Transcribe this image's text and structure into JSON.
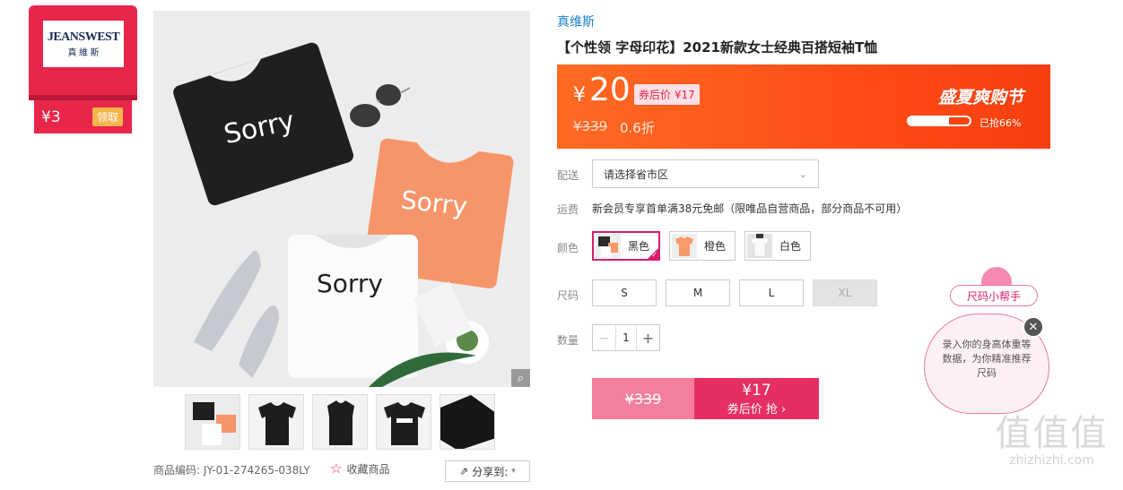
{
  "coupon": {
    "brand_logo_main": "JEANSWEST",
    "brand_logo_sub": "真 維 斯",
    "amount": "¥3",
    "claim_label": "领取"
  },
  "gallery": {
    "sku_label": "商品编码: JY-01-274265-038LY",
    "favorite_label": "收藏商品",
    "share_label": "分享到:",
    "tshirt_text": "Sorry",
    "thumbnails": [
      "thumb-1",
      "thumb-2",
      "thumb-3",
      "thumb-4",
      "thumb-5"
    ]
  },
  "product": {
    "brand": "真维斯",
    "title": "【个性领 字母印花】2021新款女士经典百搭短袖T恤"
  },
  "promo": {
    "currency": "¥",
    "price": "20",
    "after_coupon": "券后价 ¥17",
    "original_price": "¥339",
    "discount": "0.6折",
    "event_title": "盛夏爽购节",
    "sold_percent": 0.66,
    "sold_label": "已抢66%",
    "colors": {
      "start": "#ff6a23",
      "end": "#f63e0f"
    }
  },
  "shipping": {
    "label": "配送",
    "placeholder": "请选择省市区"
  },
  "freight": {
    "label": "运费",
    "text": "新会员专享首单满38元免邮（限唯品自营商品，部分商品不可用）"
  },
  "color": {
    "label": "颜色",
    "options": [
      {
        "name": "黑色",
        "selected": true,
        "swatch": "#2a2a2a"
      },
      {
        "name": "橙色",
        "selected": false,
        "swatch": "#f89a6a"
      },
      {
        "name": "白色",
        "selected": false,
        "swatch": "#f0f0f0"
      }
    ]
  },
  "size": {
    "label": "尺码",
    "options": [
      {
        "name": "S",
        "disabled": false
      },
      {
        "name": "M",
        "disabled": false
      },
      {
        "name": "L",
        "disabled": false
      },
      {
        "name": "XL",
        "disabled": true
      }
    ]
  },
  "quantity": {
    "label": "数量",
    "value": "1",
    "minus": "−",
    "plus": "+"
  },
  "buy": {
    "original_price": "¥339",
    "price": "¥17",
    "cta": "券后价 抢 ›",
    "accent": "#e52f63"
  },
  "size_helper": {
    "tag": "尺码小帮手",
    "bubble_text": "录入你的身高体重等数据，为你精准推荐尺码",
    "close": "✕"
  },
  "watermark": {
    "logo": "值值值",
    "url": "zhizhizhi.com"
  }
}
